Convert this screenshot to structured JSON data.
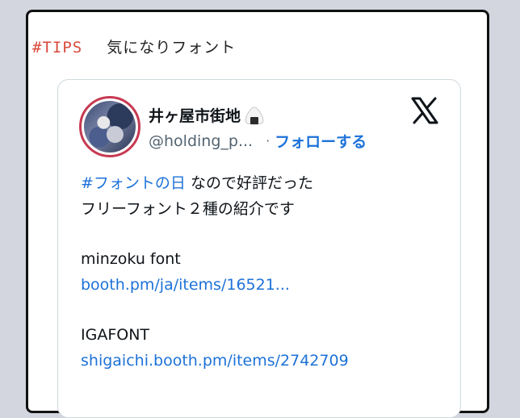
{
  "header": {
    "tag": "#TIPS",
    "title": "気になりフォント"
  },
  "tweet": {
    "display_name": "井ヶ屋市街地",
    "name_emoji": "onigiri-icon",
    "handle": "@holding_p...",
    "separator": "·",
    "follow_label": "フォローする",
    "brand_icon": "x-logo-icon",
    "body": {
      "hashtag": "#フォントの日",
      "line1_rest": " なので好評だった",
      "line2": "フリーフォント２種の紹介です",
      "font1_name": "minzoku font",
      "font1_link": "booth.pm/ja/items/16521...",
      "font2_name": "IGAFONT",
      "font2_link": "shigaichi.booth.pm/items/2742709"
    }
  },
  "colors": {
    "accent_red": "#d9483b",
    "link_blue": "#1d72d8",
    "avatar_ring": "#c63a52",
    "background": "#d3d6df"
  }
}
